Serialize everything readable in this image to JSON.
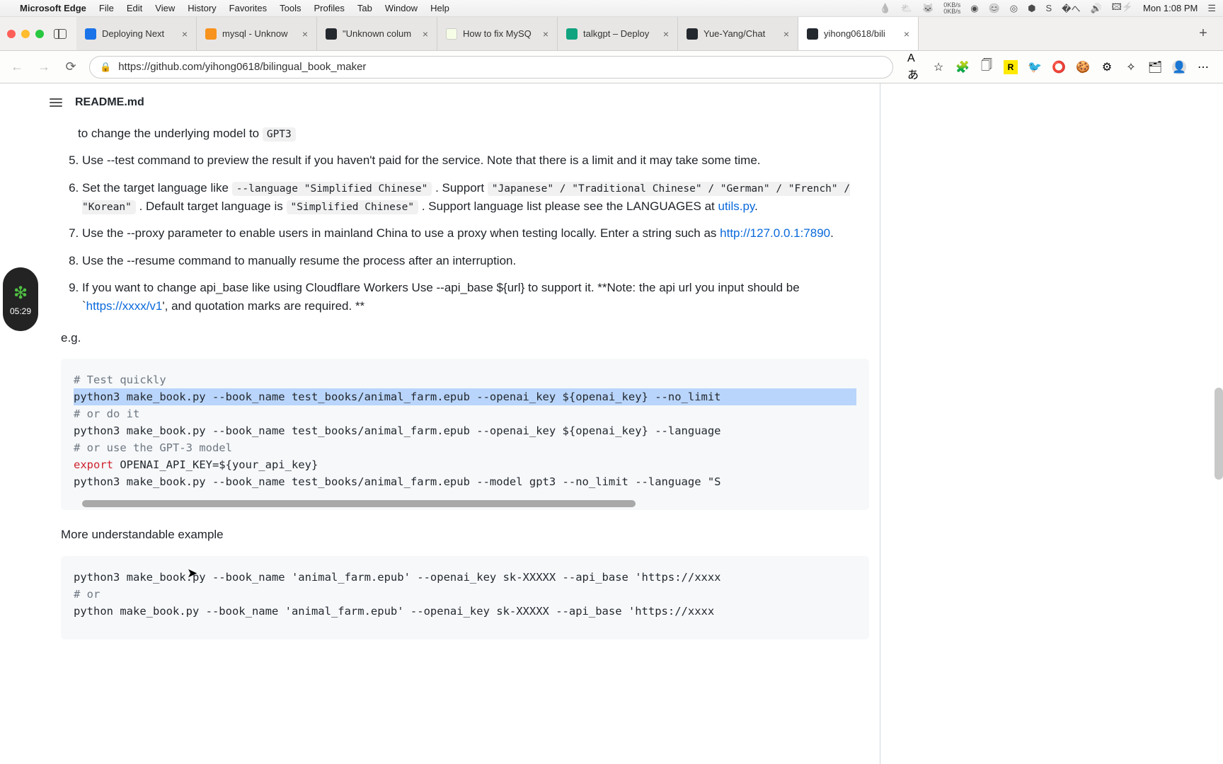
{
  "menubar": {
    "app": "Microsoft Edge",
    "items": [
      "File",
      "Edit",
      "View",
      "History",
      "Favorites",
      "Tools",
      "Profiles",
      "Tab",
      "Window",
      "Help"
    ],
    "net": {
      "up": "0KB/s",
      "down": "0KB/s"
    },
    "clock": "Mon 1:08 PM"
  },
  "tabs": [
    {
      "title": "Deploying Next",
      "fav": "blue"
    },
    {
      "title": "mysql - Unknow",
      "fav": "orange"
    },
    {
      "title": "\"Unknown colum",
      "fav": "github"
    },
    {
      "title": "How to fix MySQ",
      "fav": "light"
    },
    {
      "title": "talkgpt – Deploy",
      "fav": "chat"
    },
    {
      "title": "Yue-Yang/Chat",
      "fav": "github"
    },
    {
      "title": "yihong0618/bili",
      "fav": "github",
      "active": true
    }
  ],
  "url": "https://github.com/yihong0618/bilingual_book_maker",
  "readme_file": "README.md",
  "left_widget_time": "05:29",
  "list": {
    "i4": {
      "before": "to change the underlying model to ",
      "code": "GPT3"
    },
    "i5": "Use --test command to preview the result if you haven't paid for the service. Note that there is a limit and it may take some time.",
    "i6": {
      "t1": "Set the target language like ",
      "c1": "--language \"Simplified Chinese\"",
      "t2": " . Support ",
      "c2": "\"Japanese\" / \"Traditional Chinese\" / \"German\" / \"French\" / \"Korean\"",
      "t3": " . Default target language is ",
      "c3": "\"Simplified Chinese\"",
      "t4": " . Support language list please see the LANGUAGES at ",
      "link": "utils.py",
      "t5": "."
    },
    "i7": {
      "t1": "Use the --proxy parameter to enable users in mainland China to use a proxy when testing locally. Enter a string such as ",
      "link": "http://127.0.0.1:7890",
      "t2": "."
    },
    "i8": "Use the --resume command to manually resume the process after an interruption.",
    "i9": {
      "t1": "If you want to change api_base like using Cloudflare Workers Use --api_base ${url} to support it. **Note: the api url you input should be `",
      "link": "https://xxxx/v1",
      "t2": "', and quotation marks are required. **"
    }
  },
  "eg": "e.g.",
  "code1": {
    "l1": "# Test quickly",
    "l2": "python3 make_book.py --book_name test_books/animal_farm.epub --openai_key ${openai_key} --no_limit",
    "l3": "# or do it",
    "l4": "python3 make_book.py --book_name test_books/animal_farm.epub --openai_key ${openai_key} --language",
    "l5": "# or use the GPT-3 model",
    "l6a": "export",
    "l6b": " OPENAI_API_KEY=${your_api_key}",
    "l7": "python3 make_book.py --book_name test_books/animal_farm.epub --model gpt3 --no_limit --language \"S"
  },
  "subhead": "More understandable example",
  "code2": {
    "l1": "python3 make_book.py --book_name 'animal_farm.epub' --openai_key sk-XXXXX --api_base 'https://xxxx",
    "l2": "# or",
    "l3": "python make_book.py --book_name 'animal_farm.epub' --openai_key sk-XXXXX --api_base 'https://xxxx"
  }
}
